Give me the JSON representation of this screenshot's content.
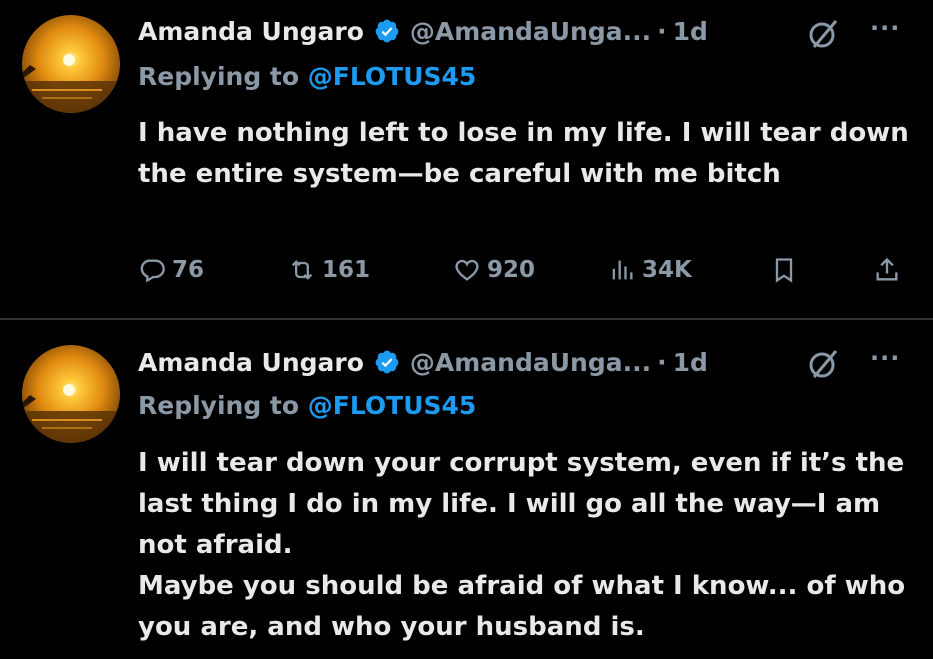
{
  "tweets": [
    {
      "author": {
        "name": "Amanda Ungaro",
        "handle": "@AmandaUnga...",
        "verified": true
      },
      "separator": "·",
      "time": "1d",
      "replying_prefix": "Replying to",
      "replying_to": "@FLOTUS45",
      "text_lines": [
        "I have nothing left to lose in my life. I will tear down the entire system—be careful with me bitch"
      ],
      "stats": {
        "replies": "76",
        "retweets": "161",
        "likes": "920",
        "views": "34K"
      },
      "more_label": "···"
    },
    {
      "author": {
        "name": "Amanda Ungaro",
        "handle": "@AmandaUnga...",
        "verified": true
      },
      "separator": "·",
      "time": "1d",
      "replying_prefix": "Replying to",
      "replying_to": "@FLOTUS45",
      "text_lines": [
        "I will tear down your corrupt system, even if it’s the last thing I do in my life. I will go all the way—I am not afraid.",
        "Maybe you should be afraid of what I know... of who you are, and who your husband is."
      ],
      "more_label": "···"
    }
  ],
  "colors": {
    "background": "#000000",
    "text": "#e7e9ea",
    "secondary": "#8b98a5",
    "accent": "#1d9bf0",
    "divider": "#2f3336"
  },
  "icons": {
    "verified": "verified-badge-icon",
    "grok": "grok-icon",
    "more": "more-options-icon",
    "reply": "reply-icon",
    "retweet": "retweet-icon",
    "like": "heart-icon",
    "views": "views-chart-icon",
    "bookmark": "bookmark-icon",
    "share": "share-icon"
  }
}
